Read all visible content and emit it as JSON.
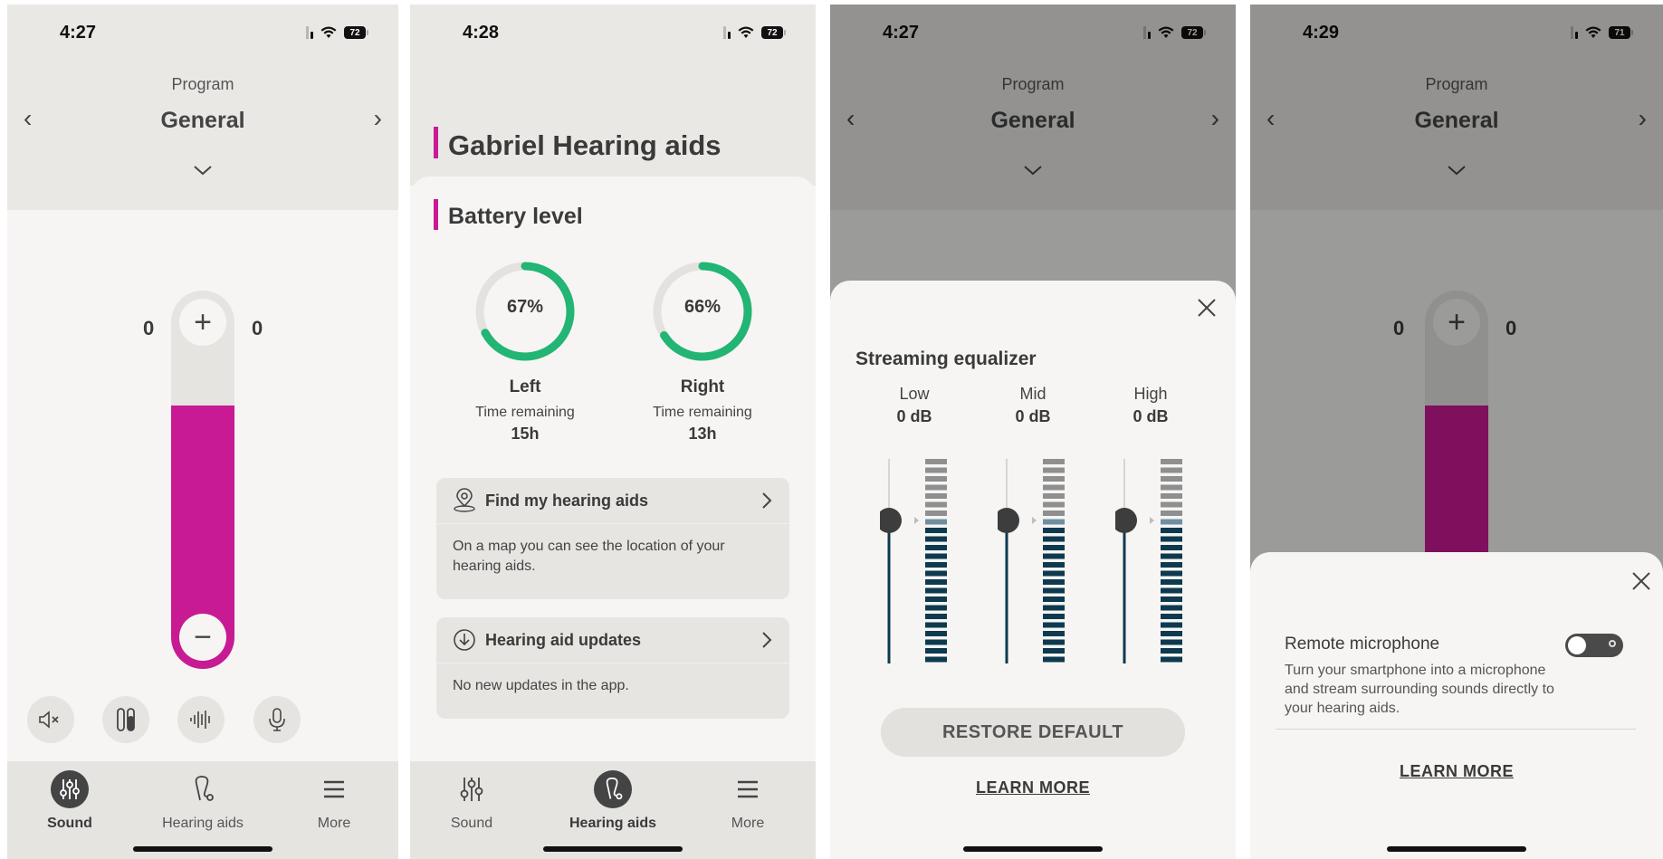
{
  "screen1": {
    "status": {
      "time": "4:27",
      "battery": "72"
    },
    "program": {
      "label": "Program",
      "name": "General"
    },
    "volume": {
      "left": "0",
      "right": "0",
      "plus": "+",
      "minus": "−",
      "level_fraction": 0.7
    },
    "quick_actions": [
      "mute-icon",
      "balance-icon",
      "soundwave-icon",
      "microphone-icon"
    ],
    "tabs": [
      {
        "label": "Sound",
        "icon": "sliders-icon",
        "active": true
      },
      {
        "label": "Hearing aids",
        "icon": "hearing-aid-icon",
        "active": false
      },
      {
        "label": "More",
        "icon": "menu-icon",
        "active": false
      }
    ]
  },
  "screen2": {
    "status": {
      "time": "4:28",
      "battery": "72"
    },
    "title": "Gabriel Hearing aids",
    "battery_section": "Battery level",
    "left": {
      "percent": "67%",
      "value": 67,
      "side": "Left",
      "time_label": "Time remaining",
      "hours": "15h"
    },
    "right": {
      "percent": "66%",
      "value": 66,
      "side": "Right",
      "time_label": "Time remaining",
      "hours": "13h"
    },
    "find": {
      "title": "Find my hearing aids",
      "body": "On a map you can see the location of your hearing aids."
    },
    "updates": {
      "title": "Hearing aid updates",
      "body": "No new updates in the app."
    },
    "tabs": [
      {
        "label": "Sound",
        "active": false
      },
      {
        "label": "Hearing aids",
        "active": true
      },
      {
        "label": "More",
        "active": false
      }
    ],
    "accent_color": "#c81a93",
    "gauge_color": "#22b573"
  },
  "screen3": {
    "status": {
      "time": "4:27",
      "battery": "72"
    },
    "program": {
      "label": "Program",
      "name": "General"
    },
    "title": "Streaming equalizer",
    "bands": [
      {
        "name": "Low",
        "value": "0 dB"
      },
      {
        "name": "Mid",
        "value": "0 dB"
      },
      {
        "name": "High",
        "value": "0 dB"
      }
    ],
    "restore": "RESTORE DEFAULT",
    "learn_more": "LEARN MORE"
  },
  "screen4": {
    "status": {
      "time": "4:29",
      "battery": "71"
    },
    "program": {
      "label": "Program",
      "name": "General"
    },
    "volume": {
      "left": "0",
      "right": "0",
      "plus": "+"
    },
    "remote_title": "Remote microphone",
    "remote_desc": "Turn your smartphone into a microphone and stream surrounding sounds directly to your hearing aids.",
    "toggle_on": false,
    "learn_more": "LEARN MORE"
  }
}
